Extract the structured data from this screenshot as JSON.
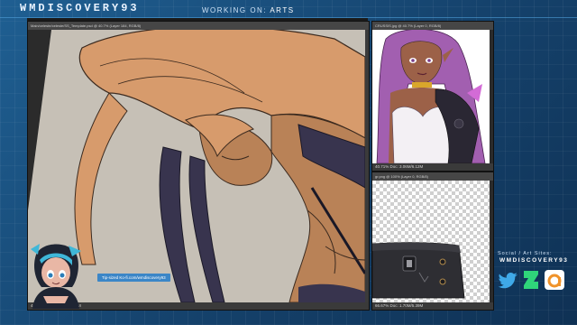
{
  "header": {
    "brand": "WMDISCOVERY93",
    "working_label": "WORKING ON:",
    "working_value": "ARTS"
  },
  "main_document": {
    "tab_title": "Main/celeste/celeste/SS_Template.psd @ 40.7% (Layer 184, RGB/8)",
    "status_text": "40.71%  Doc: 12.3M/140.5M",
    "tooltip": "Tip-sized Ko-fi.com/wmdiscovery93"
  },
  "reference_document": {
    "tab_title": "CRUSSIS.jpg @ 40.7% (Layer 0, RGB/8)",
    "status_text": "40.71%  Doc: 3.06M/6.12M"
  },
  "layer_document": {
    "tab_title": "gr.png @ 100% (Layer 0, RGB/8)",
    "status_text": "66.67%  Doc: 1.70M/5.39M"
  },
  "social": {
    "title": "Social / Art Sites:",
    "handle": "WMDISCOVERY93",
    "icons": [
      "twitter-icon",
      "deviantart-icon",
      "artstation-icon"
    ]
  },
  "colors": {
    "background": "#15426c",
    "canvas_gray": "#c6c0b6",
    "skin": "#b98257",
    "hair": "#d79b6c",
    "outfit": "#38344e",
    "accent_purple": "#a25fb0"
  }
}
